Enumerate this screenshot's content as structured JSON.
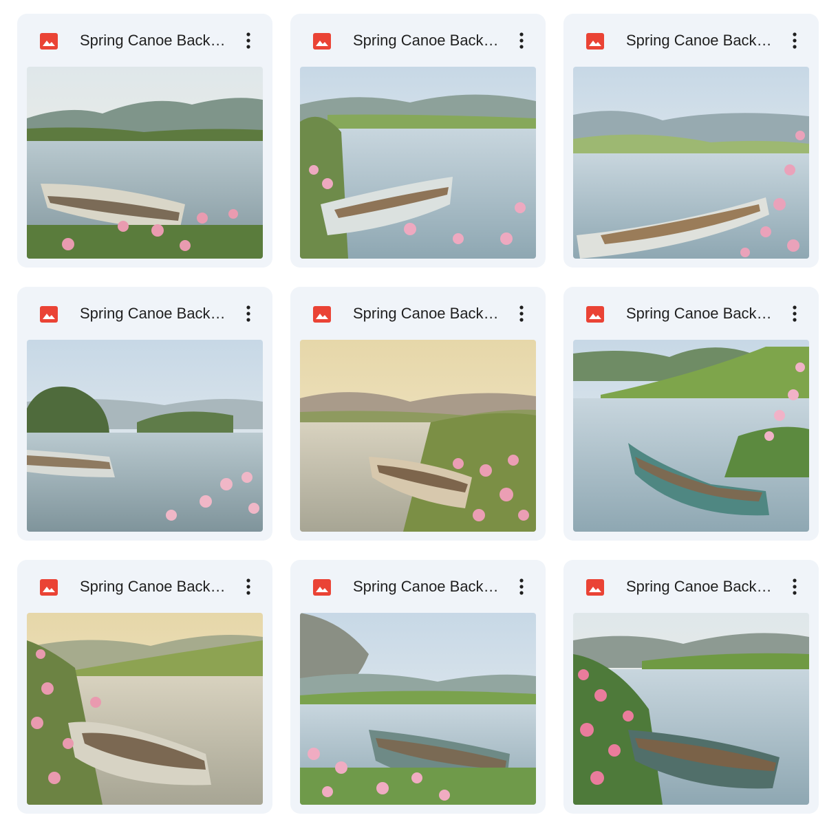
{
  "files": [
    {
      "title": "Spring Canoe Backgrounds",
      "icon": "image-file-icon",
      "icon_color": "#ea4335",
      "menu_icon": "more-vert-icon"
    },
    {
      "title": "Spring Canoe Backgrounds",
      "icon": "image-file-icon",
      "icon_color": "#ea4335",
      "menu_icon": "more-vert-icon"
    },
    {
      "title": "Spring Canoe Backgrounds",
      "icon": "image-file-icon",
      "icon_color": "#ea4335",
      "menu_icon": "more-vert-icon"
    },
    {
      "title": "Spring Canoe Backgrounds",
      "icon": "image-file-icon",
      "icon_color": "#ea4335",
      "menu_icon": "more-vert-icon"
    },
    {
      "title": "Spring Canoe Backgrounds",
      "icon": "image-file-icon",
      "icon_color": "#ea4335",
      "menu_icon": "more-vert-icon"
    },
    {
      "title": "Spring Canoe Backgrounds",
      "icon": "image-file-icon",
      "icon_color": "#ea4335",
      "menu_icon": "more-vert-icon"
    },
    {
      "title": "Spring Canoe Backgrounds",
      "icon": "image-file-icon",
      "icon_color": "#ea4335",
      "menu_icon": "more-vert-icon"
    },
    {
      "title": "Spring Canoe Backgrounds",
      "icon": "image-file-icon",
      "icon_color": "#ea4335",
      "menu_icon": "more-vert-icon"
    },
    {
      "title": "Spring Canoe Backgrounds",
      "icon": "image-file-icon",
      "icon_color": "#ea4335",
      "menu_icon": "more-vert-icon"
    }
  ],
  "colors": {
    "card_background": "#f0f4f9",
    "title_text": "#1f1f1f",
    "menu_icon": "#444746"
  }
}
